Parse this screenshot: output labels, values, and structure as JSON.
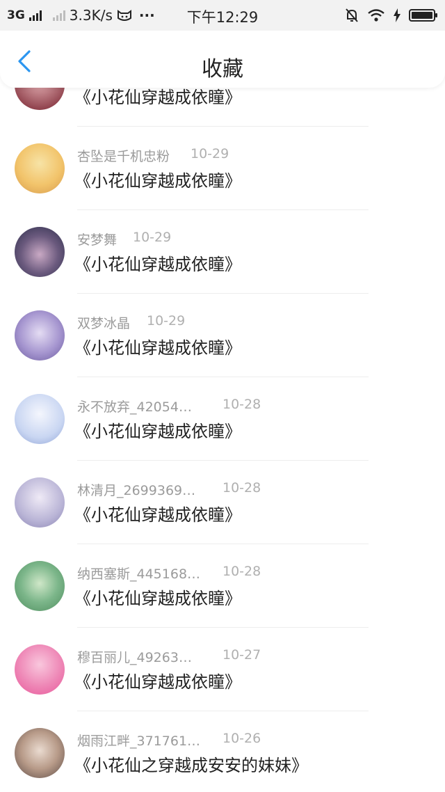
{
  "status_bar": {
    "network": "3G",
    "speed": "3.3K/s",
    "more": "···",
    "time": "下午12:29"
  },
  "header": {
    "title": "收藏",
    "back_icon": "chevron-left-icon",
    "accent_color": "#2b96f0"
  },
  "items": [
    {
      "user": "",
      "date": "",
      "book": "《小花仙穿越成依瞳》",
      "avatar_colors": [
        "#8a3b46",
        "#e8b4b8"
      ]
    },
    {
      "user": "杏坠是千机忠粉",
      "date": "10-29",
      "book": "《小花仙穿越成依瞳》",
      "avatar_colors": [
        "#f2c46b",
        "#f7e3a6"
      ]
    },
    {
      "user": "安梦舞",
      "date": "10-29",
      "book": "《小花仙穿越成依瞳》",
      "avatar_colors": [
        "#2b2d4a",
        "#c9a9c4"
      ]
    },
    {
      "user": "双梦冰晶",
      "date": "10-29",
      "book": "《小花仙穿越成依瞳》",
      "avatar_colors": [
        "#6a5a9e",
        "#e4dcf3"
      ]
    },
    {
      "user": "永不放弃_42054…",
      "date": "10-28",
      "book": "《小花仙穿越成依瞳》",
      "avatar_colors": [
        "#c9d6f2",
        "#f4f6fd"
      ]
    },
    {
      "user": "林清月_2699369…",
      "date": "10-28",
      "book": "《小花仙穿越成依瞳》",
      "avatar_colors": [
        "#b9b4d6",
        "#efeaf6"
      ]
    },
    {
      "user": "纳西塞斯_445168…",
      "date": "10-28",
      "book": "《小花仙穿越成依瞳》",
      "avatar_colors": [
        "#4e8d5e",
        "#cfe7c8"
      ]
    },
    {
      "user": "穆百丽儿_49263…",
      "date": "10-27",
      "book": "《小花仙穿越成依瞳》",
      "avatar_colors": [
        "#e8579a",
        "#f9c7dd"
      ]
    },
    {
      "user": "烟雨江畔_371761…",
      "date": "10-26",
      "book": "《小花仙之穿越成安安的妹妹》",
      "avatar_colors": [
        "#5b4a45",
        "#eadbd0"
      ]
    }
  ]
}
